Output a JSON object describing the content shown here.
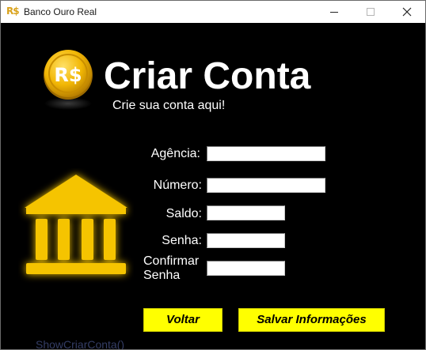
{
  "window": {
    "title": "Banco Ouro Real",
    "app_icon_glyph": "R$",
    "controls": {
      "minimize": "minimize-icon",
      "maximize": "maximize-icon",
      "close": "close-icon"
    }
  },
  "logo": {
    "coin_text": "R$",
    "coin_icon": "coin-icon",
    "bank_icon": "bank-building-icon"
  },
  "header": {
    "title": "Criar Conta",
    "subtitle": "Crie sua conta aqui!"
  },
  "form": {
    "agencia": {
      "label": "Agência:",
      "value": ""
    },
    "numero": {
      "label": "Número:",
      "value": ""
    },
    "saldo": {
      "label": "Saldo:",
      "value": ""
    },
    "senha": {
      "label": "Senha:",
      "value": ""
    },
    "confirmar_senha": {
      "label": "Confirmar\nSenha",
      "value": ""
    }
  },
  "buttons": {
    "back_label": "Voltar",
    "save_label": "Salvar Informações"
  },
  "background_text": "ShowCriarConta()",
  "colors": {
    "background": "#000000",
    "accent_yellow": "#ffff00",
    "gold": "#f2b705",
    "text": "#ffffff"
  }
}
